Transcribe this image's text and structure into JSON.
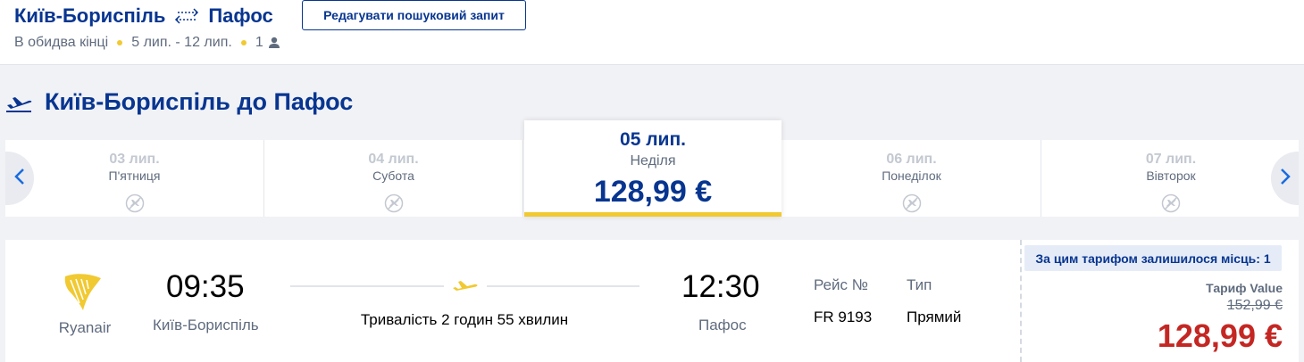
{
  "header": {
    "origin": "Київ-Бориспіль",
    "destination": "Пафос",
    "edit_label": "Редагувати пошуковий запит",
    "trip_type": "В обидва кінці",
    "dates": "5 лип. - 12 лип.",
    "passengers": "1",
    "swap_icon": "round-trip-arrows-icon",
    "person_icon": "person-icon"
  },
  "section": {
    "title": "Київ-Бориспіль до Пафос",
    "icon": "plane-takeoff-icon"
  },
  "carousel": {
    "days": [
      {
        "date": "03 лип.",
        "weekday": "П'ятниця",
        "icon": "no-flight-icon"
      },
      {
        "date": "04 лип.",
        "weekday": "Субота",
        "icon": "no-flight-icon"
      },
      {
        "date": "06 лип.",
        "weekday": "Понеділок",
        "icon": "no-flight-icon"
      },
      {
        "date": "07 лип.",
        "weekday": "Вівторок",
        "icon": "no-flight-icon"
      }
    ],
    "selected": {
      "date": "05 лип.",
      "weekday": "Неділя",
      "price": "128,99 €"
    },
    "prev_icon": "chevron-left-icon",
    "next_icon": "chevron-right-icon"
  },
  "flight": {
    "airline": "Ryanair",
    "depart_time": "09:35",
    "depart_city": "Київ-Бориспіль",
    "arrive_time": "12:30",
    "arrive_city": "Пафос",
    "duration": "Тривалість 2 годин 55 хвилин",
    "flight_no_label": "Рейс №",
    "flight_no": "FR 9193",
    "type_label": "Тип",
    "type": "Прямий",
    "seats_left": "За цим тарифом залишилося місць: 1",
    "fare_name": "Тариф Value",
    "old_price": "152,99 €",
    "price": "128,99 €"
  },
  "colors": {
    "brand_blue": "#073590",
    "accent_yellow": "#f1c931",
    "price_red": "#c42723"
  }
}
